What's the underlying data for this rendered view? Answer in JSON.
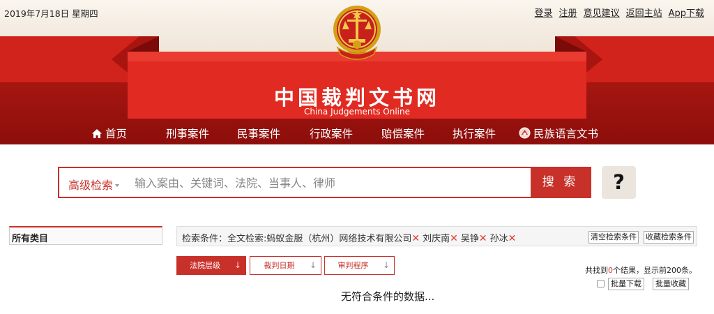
{
  "header": {
    "date": "2019年7月18日 星期四",
    "links": [
      "登录",
      "注册",
      "意见建议",
      "返回主站",
      "App下载"
    ],
    "title": "中国裁判文书网",
    "subtitle": "China Judgements Online"
  },
  "nav": {
    "items": [
      {
        "label": "首页",
        "icon": "home-icon"
      },
      {
        "label": "刑事案件"
      },
      {
        "label": "民事案件"
      },
      {
        "label": "行政案件"
      },
      {
        "label": "赔偿案件"
      },
      {
        "label": "执行案件"
      },
      {
        "label": "民族语言文书",
        "icon": "ethnic-language-icon"
      }
    ]
  },
  "search": {
    "advanced_label": "高级检索",
    "placeholder": "输入案由、关键词、法院、当事人、律师",
    "button_label": "搜 索",
    "help_label": "?"
  },
  "sidebar": {
    "category_title": "所有类目"
  },
  "criteria": {
    "prefix": "检索条件：",
    "tags": [
      "全文检索:蚂蚁金服（杭州）网络技术有限公司",
      "刘庆南",
      "吴铮",
      "孙冰"
    ],
    "remove_icon": "close-icon",
    "clear_button": "清空检索条件",
    "save_button": "收藏检索条件"
  },
  "sort_tabs": [
    {
      "label": "法院层级",
      "active": true
    },
    {
      "label": "裁判日期",
      "active": false
    },
    {
      "label": "审判程序",
      "active": false
    }
  ],
  "results": {
    "prefix": "共找到",
    "count": "0",
    "suffix": "个结果，显示前200条。",
    "bulk_download": "批量下载",
    "bulk_save": "批量收藏",
    "empty_message": "无符合条件的数据..."
  },
  "colors": {
    "brand_red": "#c8302a",
    "header_dark_red": "#8c0e0b",
    "remove_red": "#e23a2e"
  }
}
